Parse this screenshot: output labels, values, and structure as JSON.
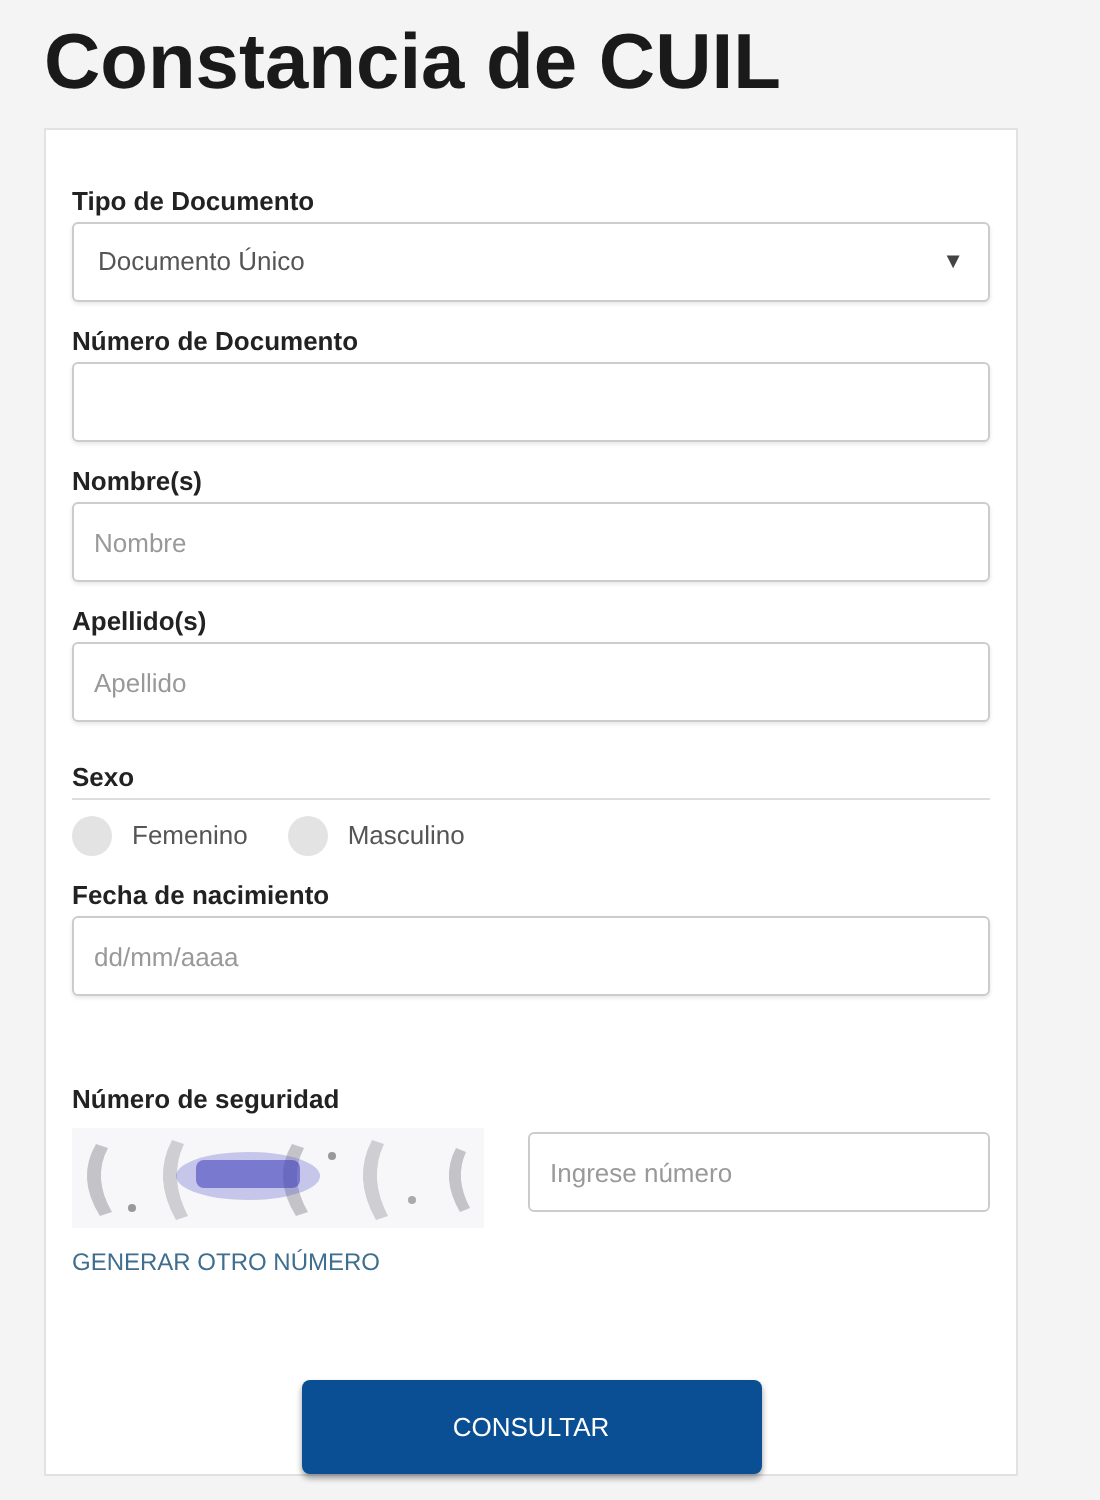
{
  "title": "Constancia de CUIL",
  "fields": [
    {
      "kind": "select",
      "label": "Tipo de Documento",
      "value": "Documento Único",
      "caret": "▼"
    },
    {
      "kind": "text",
      "label": "Número de Documento"
    },
    {
      "kind": "text",
      "label": "Nombre(s)",
      "placeholder": "Nombre"
    },
    {
      "kind": "text",
      "label": "Apellido(s)",
      "placeholder": "Apellido"
    },
    {
      "kind": "radio",
      "label": "Sexo",
      "options": [
        {
          "label": "Femenino",
          "selected": false
        },
        {
          "label": "Masculino",
          "selected": false
        }
      ]
    },
    {
      "kind": "text",
      "label": "Fecha de nacimiento",
      "placeholder": "dd/mm/aaaa"
    }
  ],
  "security": {
    "label": "Número de seguridad",
    "placeholder": "Ingrese número",
    "link": "GENERAR OTRO NÚMERO"
  },
  "submit": "CONSULTAR"
}
